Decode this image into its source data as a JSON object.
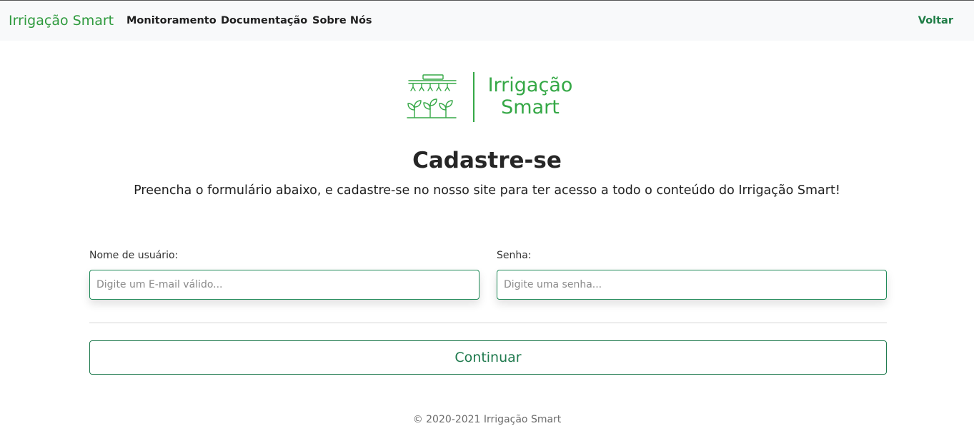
{
  "navbar": {
    "brand": "Irrigação Smart",
    "links": [
      "Monitoramento",
      "Documentação",
      "Sobre Nós"
    ],
    "back": "Voltar"
  },
  "logo": {
    "line1": "Irrigação",
    "line2": "Smart"
  },
  "page": {
    "title": "Cadastre-se",
    "subtitle": "Preencha o formulário abaixo, e cadastre-se no nosso site para ter acesso a todo o conteúdo do Irrigação Smart!"
  },
  "form": {
    "username_label": "Nome de usuário:",
    "username_placeholder": "Digite um E-mail válido...",
    "username_value": "",
    "password_label": "Senha:",
    "password_placeholder": "Digite uma senha...",
    "password_value": "",
    "submit_label": "Continuar"
  },
  "footer": {
    "copyright": "© 2020-2021 Irrigação Smart"
  },
  "colors": {
    "brand_green": "#2e9a3d",
    "accent_green": "#1f7a4e",
    "navbar_bg": "#f8f9fa"
  }
}
